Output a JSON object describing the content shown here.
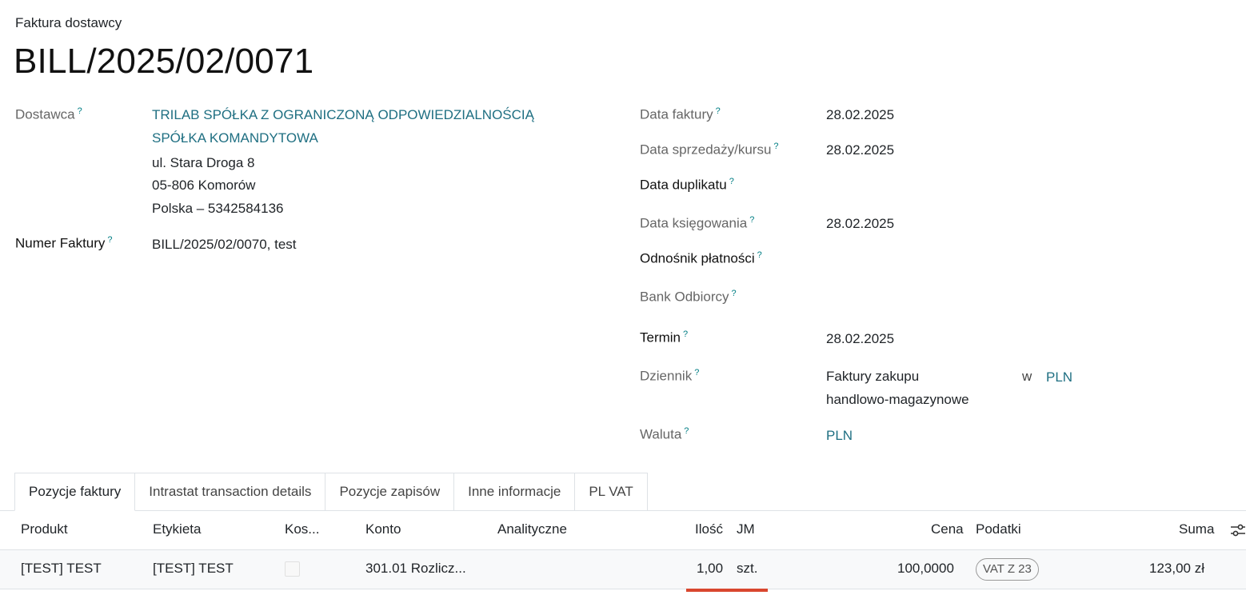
{
  "header": {
    "subtitle": "Faktura dostawcy",
    "title": "BILL/2025/02/0071"
  },
  "left": {
    "vendor_label": "Dostawca",
    "vendor_name_line1": "TRILAB SPÓŁKA Z OGRANICZONĄ ODPOWIEDZIALNOŚCIĄ",
    "vendor_name_line2": "SPÓŁKA KOMANDYTOWA",
    "address_line1": "ul. Stara Droga 8",
    "address_line2": "05-806 Komorów",
    "address_line3": "Polska – 5342584136",
    "invoice_number_label": "Numer Faktury",
    "invoice_number_value": "BILL/2025/02/0070, test"
  },
  "right": {
    "invoice_date_label": "Data faktury",
    "invoice_date_value": "28.02.2025",
    "sale_date_label": "Data sprzedaży/kursu",
    "sale_date_value": "28.02.2025",
    "duplicate_date_label": "Data duplikatu",
    "accounting_date_label": "Data księgowania",
    "accounting_date_value": "28.02.2025",
    "payment_ref_label": "Odnośnik płatności",
    "bank_label": "Bank Odbiorcy",
    "due_label": "Termin",
    "due_value": "28.02.2025",
    "journal_label": "Dziennik",
    "journal_value_line1": "Faktury zakupu",
    "journal_value_line2": "handlowo-magazynowe",
    "journal_in": "w",
    "journal_currency": "PLN",
    "currency_label": "Waluta",
    "currency_value": "PLN",
    "help_mark": "?"
  },
  "tabs": [
    {
      "label": "Pozycje faktury"
    },
    {
      "label": "Intrastat transaction details"
    },
    {
      "label": "Pozycje zapisów"
    },
    {
      "label": "Inne informacje"
    },
    {
      "label": "PL VAT"
    }
  ],
  "table": {
    "headers": {
      "product": "Produkt",
      "label": "Etykieta",
      "cost": "Kos...",
      "account": "Konto",
      "analytic": "Analityczne",
      "qty": "Ilość",
      "uom": "JM",
      "price": "Cena",
      "taxes": "Podatki",
      "total": "Suma"
    },
    "rows": [
      {
        "product": "[TEST] TEST",
        "label": "[TEST] TEST",
        "account": "301.01 Rozlicz...",
        "qty": "1,00",
        "uom": "szt.",
        "price": "100,0000",
        "tax": "VAT Z 23",
        "total": "123,00 zł"
      }
    ]
  },
  "colors": {
    "link": "#1f6f82",
    "accent_underline": "#d9472f",
    "help": "#017e84"
  }
}
